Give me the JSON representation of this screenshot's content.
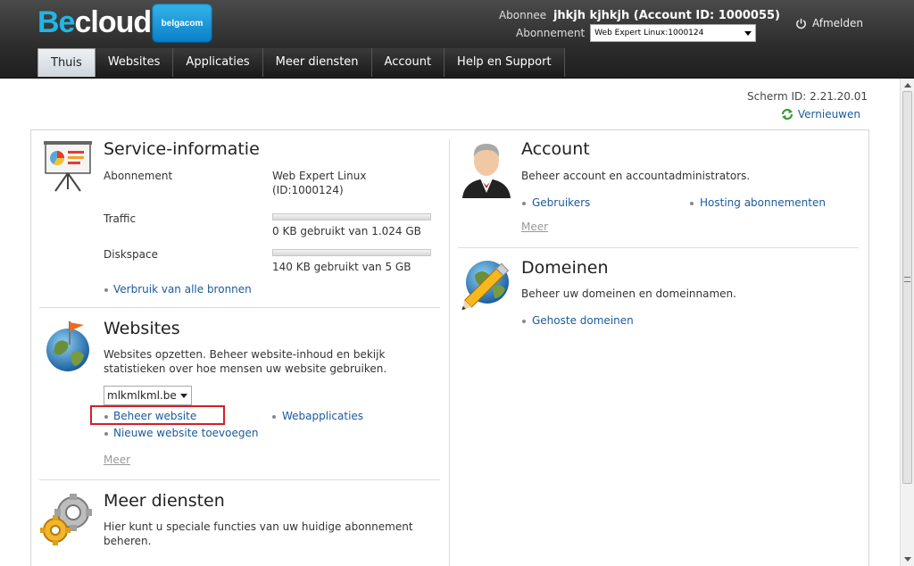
{
  "header": {
    "logo_be": "Be",
    "logo_cloud": "cloud",
    "partner_logo": "belgacom",
    "subscriber_label": "Abonnee",
    "subscriber_name": "jhkjh kjhkjh (Account ID: 1000055)",
    "subscription_label": "Abonnement",
    "subscription_value": "Web Expert Linux:1000124",
    "logout_label": "Afmelden"
  },
  "tabs": [
    {
      "label": "Thuis",
      "active": true
    },
    {
      "label": "Websites"
    },
    {
      "label": "Applicaties"
    },
    {
      "label": "Meer diensten"
    },
    {
      "label": "Account"
    },
    {
      "label": "Help en Support"
    }
  ],
  "page": {
    "screen_id": "Scherm ID:  2.21.20.01",
    "refresh_label": "Vernieuwen"
  },
  "service_info": {
    "title": "Service-informatie",
    "subscription_label": "Abonnement",
    "subscription_value_1": "Web Expert Linux",
    "subscription_value_2": "(ID:1000124)",
    "traffic_label": "Traffic",
    "traffic_value": "0 KB gebruikt van 1.024 GB",
    "traffic_fraction": 0,
    "diskspace_label": "Diskspace",
    "diskspace_value": "140 KB gebruikt van 5 GB",
    "diskspace_fraction": 0,
    "usage_link": "Verbruik van alle bronnen"
  },
  "websites": {
    "title": "Websites",
    "desc_1": "Websites opzetten. Beheer website-inhoud en bekijk",
    "desc_2": "statistieken over hoe mensen uw website gebruiken.",
    "selected_site": "mlkmlkml.be",
    "manage_link": "Beheer website",
    "webapps_link": "Webapplicaties",
    "add_link": "Nieuwe website toevoegen",
    "more_link": "Meer"
  },
  "more_services": {
    "title": "Meer diensten",
    "desc_1": "Hier kunt u speciale functies van uw huidige abonnement",
    "desc_2": "beheren."
  },
  "account": {
    "title": "Account",
    "desc": "Beheer account en accountadministrators.",
    "users_link": "Gebruikers",
    "hosting_link": "Hosting abonnementen",
    "more_link": "Meer"
  },
  "domains": {
    "title": "Domeinen",
    "desc": "Beheer uw domeinen en domeinnamen.",
    "hosted_link": "Gehoste domeinen"
  },
  "colors": {
    "accent": "#22b5e6",
    "link": "#1a5a99",
    "highlight": "#d32027"
  }
}
